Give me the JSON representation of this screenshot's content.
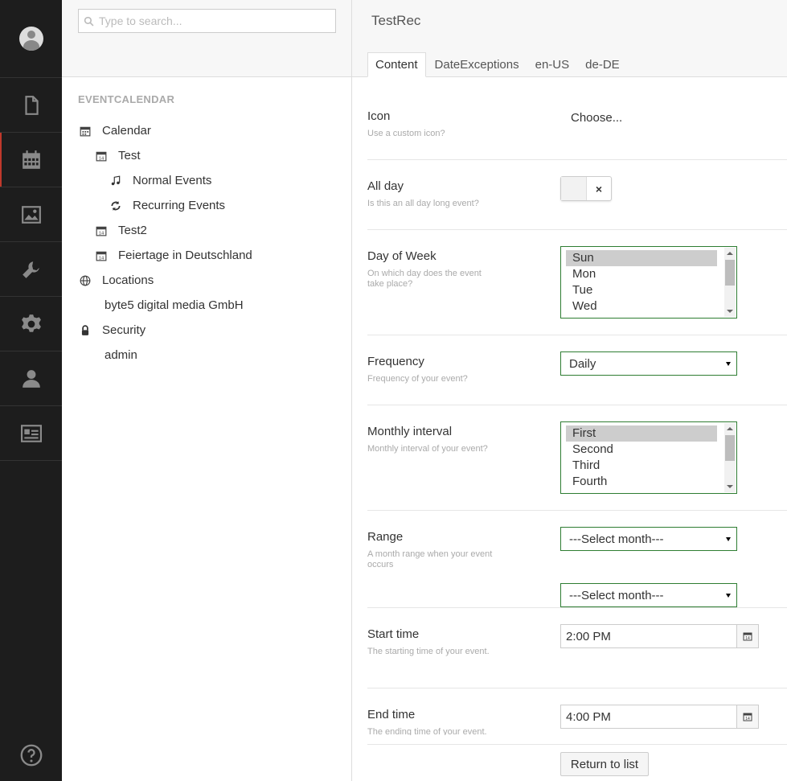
{
  "rail": {
    "items": [
      {
        "icon": "document-icon"
      },
      {
        "icon": "calendar-icon",
        "active": true
      },
      {
        "icon": "image-icon"
      },
      {
        "icon": "wrench-icon"
      },
      {
        "icon": "gear-icon"
      },
      {
        "icon": "user-icon"
      },
      {
        "icon": "id-card-icon"
      }
    ],
    "help_icon": "help-icon"
  },
  "tree": {
    "search_placeholder": "Type to search...",
    "section_title": "EVENTCALENDAR",
    "items": [
      {
        "label": "Calendar",
        "icon": "calendar-icon"
      },
      {
        "label": "Test",
        "icon": "calendar-icon"
      },
      {
        "label": "Normal Events",
        "icon": "music-note-icon"
      },
      {
        "label": "Recurring Events",
        "icon": "refresh-icon"
      },
      {
        "label": "Test2",
        "icon": "calendar-icon"
      },
      {
        "label": "Feiertage in Deutschland",
        "icon": "calendar-icon"
      },
      {
        "label": "Locations",
        "icon": "globe-icon"
      },
      {
        "label": "byte5 digital media GmbH",
        "icon": ""
      },
      {
        "label": "Security",
        "icon": "lock-icon"
      },
      {
        "label": "admin",
        "icon": ""
      }
    ]
  },
  "main": {
    "title": "TestRec",
    "tabs": [
      {
        "label": "Content",
        "active": true
      },
      {
        "label": "DateExceptions"
      },
      {
        "label": "en-US"
      },
      {
        "label": "de-DE"
      }
    ],
    "fields": {
      "icon": {
        "label": "Icon",
        "hint": "Use a custom icon?",
        "value": "Choose..."
      },
      "all_day": {
        "label": "All day",
        "hint": "Is this an all day long event?",
        "toggle_symbol": "×"
      },
      "day_of_week": {
        "label": "Day of Week",
        "hint": "On which day does the event take place?",
        "options": [
          "Sun",
          "Mon",
          "Tue",
          "Wed"
        ],
        "selected": "Sun"
      },
      "frequency": {
        "label": "Frequency",
        "hint": "Frequency of your event?",
        "value": "Daily"
      },
      "monthly_interval": {
        "label": "Monthly interval",
        "hint": "Monthly interval of your event?",
        "options": [
          "First",
          "Second",
          "Third",
          "Fourth"
        ],
        "selected": "First"
      },
      "range": {
        "label": "Range",
        "hint": "A month range when your event occurs",
        "from": "---Select month---",
        "to": "---Select month---"
      },
      "start_time": {
        "label": "Start time",
        "hint": "The starting time of your event.",
        "value": "2:00 PM"
      },
      "end_time": {
        "label": "End time",
        "hint": "The ending time of your event.",
        "value": "4:00 PM"
      }
    },
    "return_button": "Return to list"
  }
}
